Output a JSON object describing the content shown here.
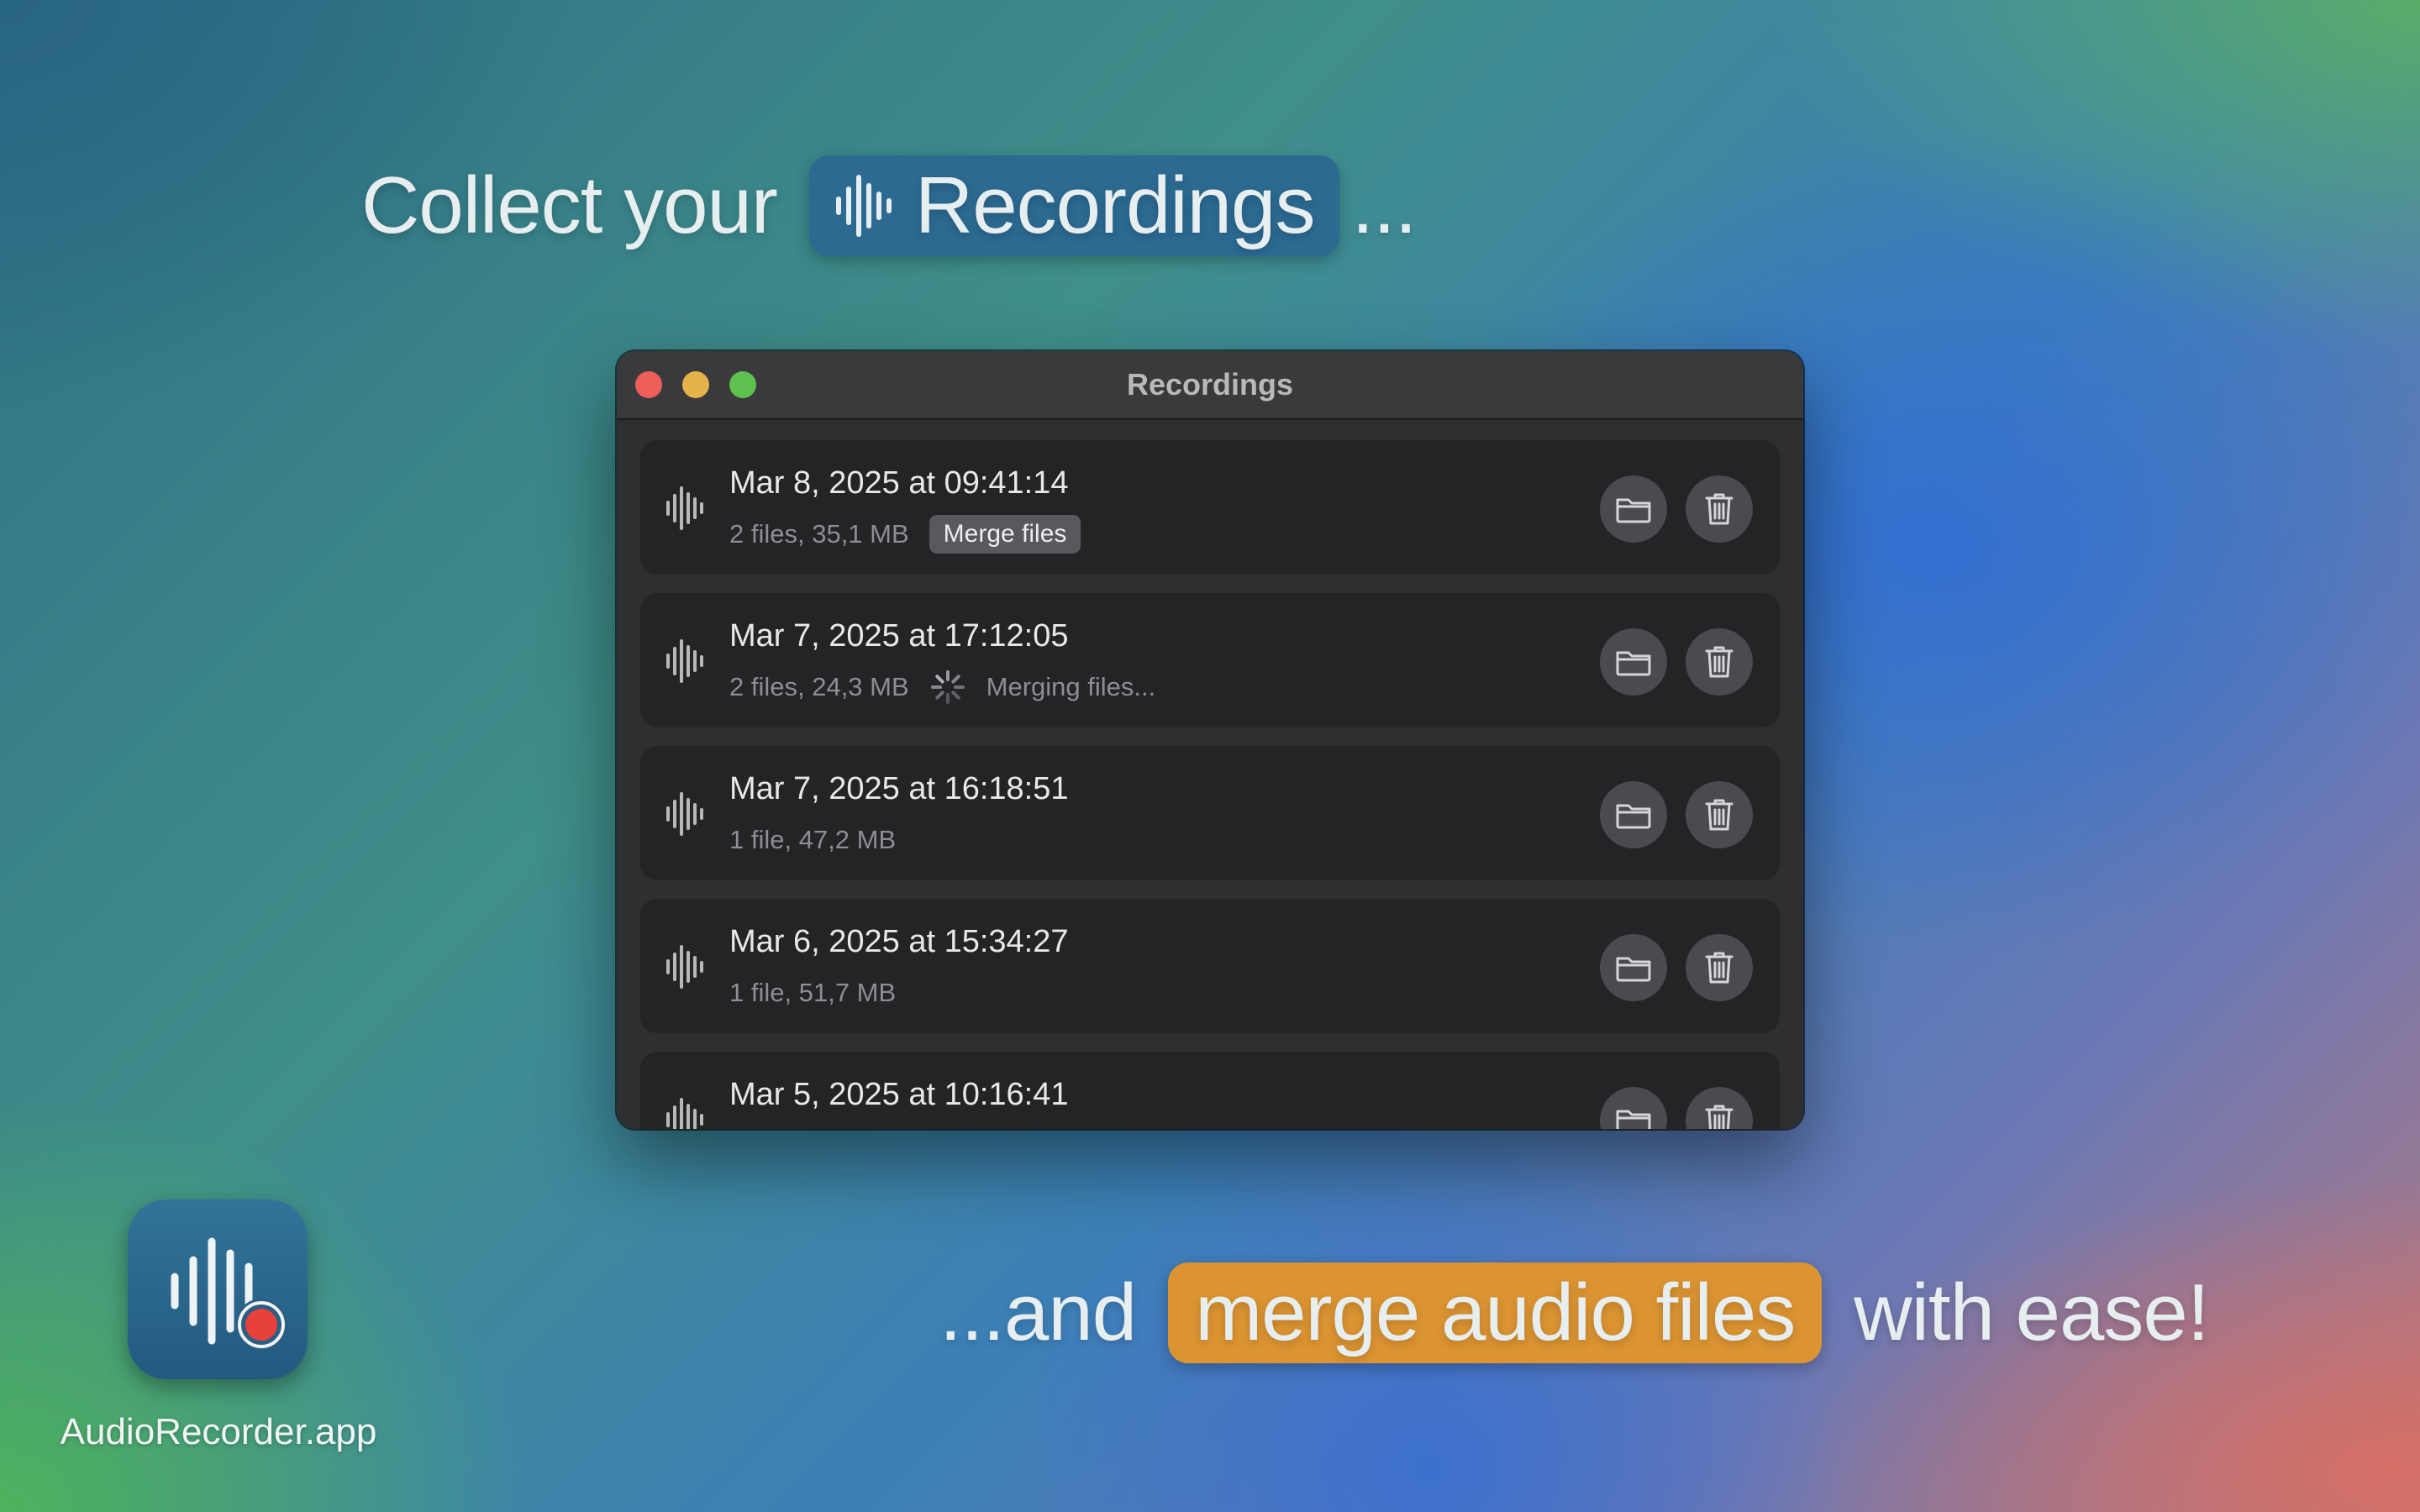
{
  "headline_top": {
    "prefix": "Collect your",
    "pill_label": "Recordings",
    "suffix": "..."
  },
  "headline_bottom": {
    "prefix": "...and",
    "pill_label": "merge audio files",
    "suffix": "with ease!"
  },
  "window": {
    "title": "Recordings"
  },
  "recordings": [
    {
      "title": "Mar 8, 2025 at 09:41:14",
      "meta": "2 files, 35,1 MB",
      "action_label": "Merge files",
      "status": null
    },
    {
      "title": "Mar 7, 2025 at 17:12:05",
      "meta": "2 files, 24,3 MB",
      "action_label": null,
      "status": "Merging files..."
    },
    {
      "title": "Mar 7, 2025 at 16:18:51",
      "meta": "1 file, 47,2 MB",
      "action_label": null,
      "status": null
    },
    {
      "title": "Mar 6, 2025 at 15:34:27",
      "meta": "1 file, 51,7 MB",
      "action_label": null,
      "status": null
    },
    {
      "title": "Mar 5, 2025 at 10:16:41",
      "meta": "",
      "action_label": null,
      "status": null
    }
  ],
  "app": {
    "name": "AudioRecorder.app"
  },
  "colors": {
    "pill_blue": "#2c6a92",
    "pill_orange": "#dc9432",
    "record_red": "#e8413b"
  },
  "icons": [
    "waveform-icon",
    "folder-icon",
    "trash-icon",
    "spinner-icon",
    "record-icon"
  ]
}
